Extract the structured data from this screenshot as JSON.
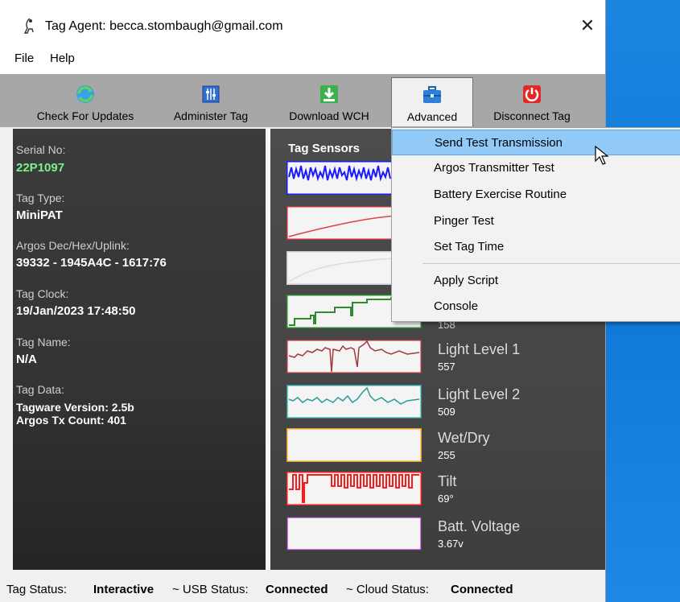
{
  "window": {
    "title": "Tag Agent: becca.stombaugh@gmail.com",
    "close_glyph": "✕"
  },
  "menu": {
    "items": [
      "File",
      "Help"
    ]
  },
  "toolbar": {
    "buttons": [
      {
        "label": "Check For Updates",
        "icon": "refresh-globe-icon"
      },
      {
        "label": "Administer Tag",
        "icon": "sliders-icon"
      },
      {
        "label": "Download WCH",
        "icon": "download-arrow-icon"
      },
      {
        "label": "Advanced",
        "icon": "toolbox-icon"
      },
      {
        "label": "Disconnect Tag",
        "icon": "power-icon"
      }
    ]
  },
  "tag_info": {
    "serial_label": "Serial No:",
    "serial_value": "22P1097",
    "type_label": "Tag Type:",
    "type_value": "MiniPAT",
    "argos_label": "Argos Dec/Hex/Uplink:",
    "argos_value": "39332 - 1945A4C - 1617:76",
    "clock_label": "Tag Clock:",
    "clock_value": "19/Jan/2023 17:48:50",
    "name_label": "Tag Name:",
    "name_value": "N/A",
    "data_label": "Tag Data:",
    "data_line1": "Tagware Version: 2.5b",
    "data_line2": "Argos Tx Count: 401"
  },
  "sensors": {
    "title": "Tag Sensors",
    "items": [
      {
        "name": "",
        "value": ""
      },
      {
        "name": "",
        "value": ""
      },
      {
        "name": "",
        "value": ""
      },
      {
        "name": "",
        "value": "158"
      },
      {
        "name": "Light Level 1",
        "value": "557"
      },
      {
        "name": "Light Level 2",
        "value": "509"
      },
      {
        "name": "Wet/Dry",
        "value": "255"
      },
      {
        "name": "Tilt",
        "value": "69°"
      },
      {
        "name": "Batt. Voltage",
        "value": "3.67v"
      }
    ],
    "colors": [
      "#1a1aff",
      "#e0404a",
      "#cccccc",
      "#2e8b2e",
      "#a0383c",
      "#2a9a96",
      "#f0a020",
      "#ff1a1a",
      "#7a2a8a"
    ]
  },
  "advanced_menu": {
    "items": [
      "Send Test Transmission",
      "Argos Transmitter Test",
      "Battery Exercise Routine",
      "Pinger Test",
      "Set Tag Time",
      "Apply Script",
      "Console"
    ],
    "highlighted": "Send Test Transmission"
  },
  "status": {
    "tag_label": "Tag Status:",
    "tag_value": "Interactive",
    "usb_label": "~ USB Status:",
    "usb_value": "Connected",
    "cloud_label": "~ Cloud Status:",
    "cloud_value": "Connected"
  }
}
